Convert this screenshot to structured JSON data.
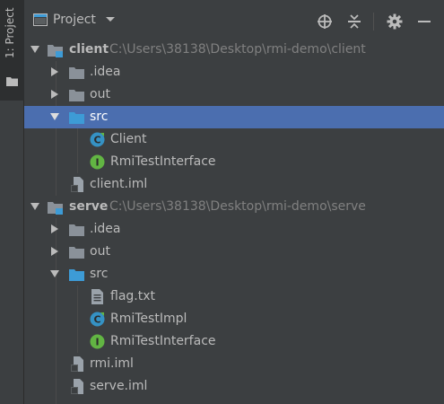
{
  "side_stripe": {
    "label": "1: Project"
  },
  "header": {
    "title": "Project",
    "buttons": [
      {
        "name": "locate-icon",
        "glyph": "⊕"
      },
      {
        "name": "collapse-icon",
        "glyph": "⇕"
      },
      {
        "name": "gear-icon",
        "glyph": "⚙"
      },
      {
        "name": "minimize-icon",
        "glyph": "—"
      }
    ]
  },
  "tree": {
    "rows": [
      {
        "label": "client",
        "path": "C:\\Users\\38138\\Desktop\\rmi-demo\\client",
        "icon": "module-folder"
      },
      {
        "label": ".idea",
        "icon": "folder"
      },
      {
        "label": "out",
        "icon": "folder"
      },
      {
        "label": "src",
        "icon": "source-folder"
      },
      {
        "label": "Client",
        "icon": "class"
      },
      {
        "label": "RmiTestInterface",
        "icon": "interface"
      },
      {
        "label": "client.iml",
        "icon": "iml-file"
      },
      {
        "label": "serve",
        "path": "C:\\Users\\38138\\Desktop\\rmi-demo\\serve",
        "icon": "module-folder"
      },
      {
        "label": ".idea",
        "icon": "folder"
      },
      {
        "label": "out",
        "icon": "folder"
      },
      {
        "label": "src",
        "icon": "source-folder"
      },
      {
        "label": "flag.txt",
        "icon": "text-file"
      },
      {
        "label": "RmiTestImpl",
        "icon": "class"
      },
      {
        "label": "RmiTestInterface",
        "icon": "interface"
      },
      {
        "label": "rmi.iml",
        "icon": "iml-file"
      },
      {
        "label": "serve.iml",
        "icon": "iml-file"
      }
    ]
  },
  "colors": {
    "background": "#3c3f41",
    "selection": "#4b6eaf",
    "folder": "#8a9199",
    "source_folder": "#3d9bd6",
    "class_icon": "#3592c4",
    "interface_icon": "#62b543"
  }
}
